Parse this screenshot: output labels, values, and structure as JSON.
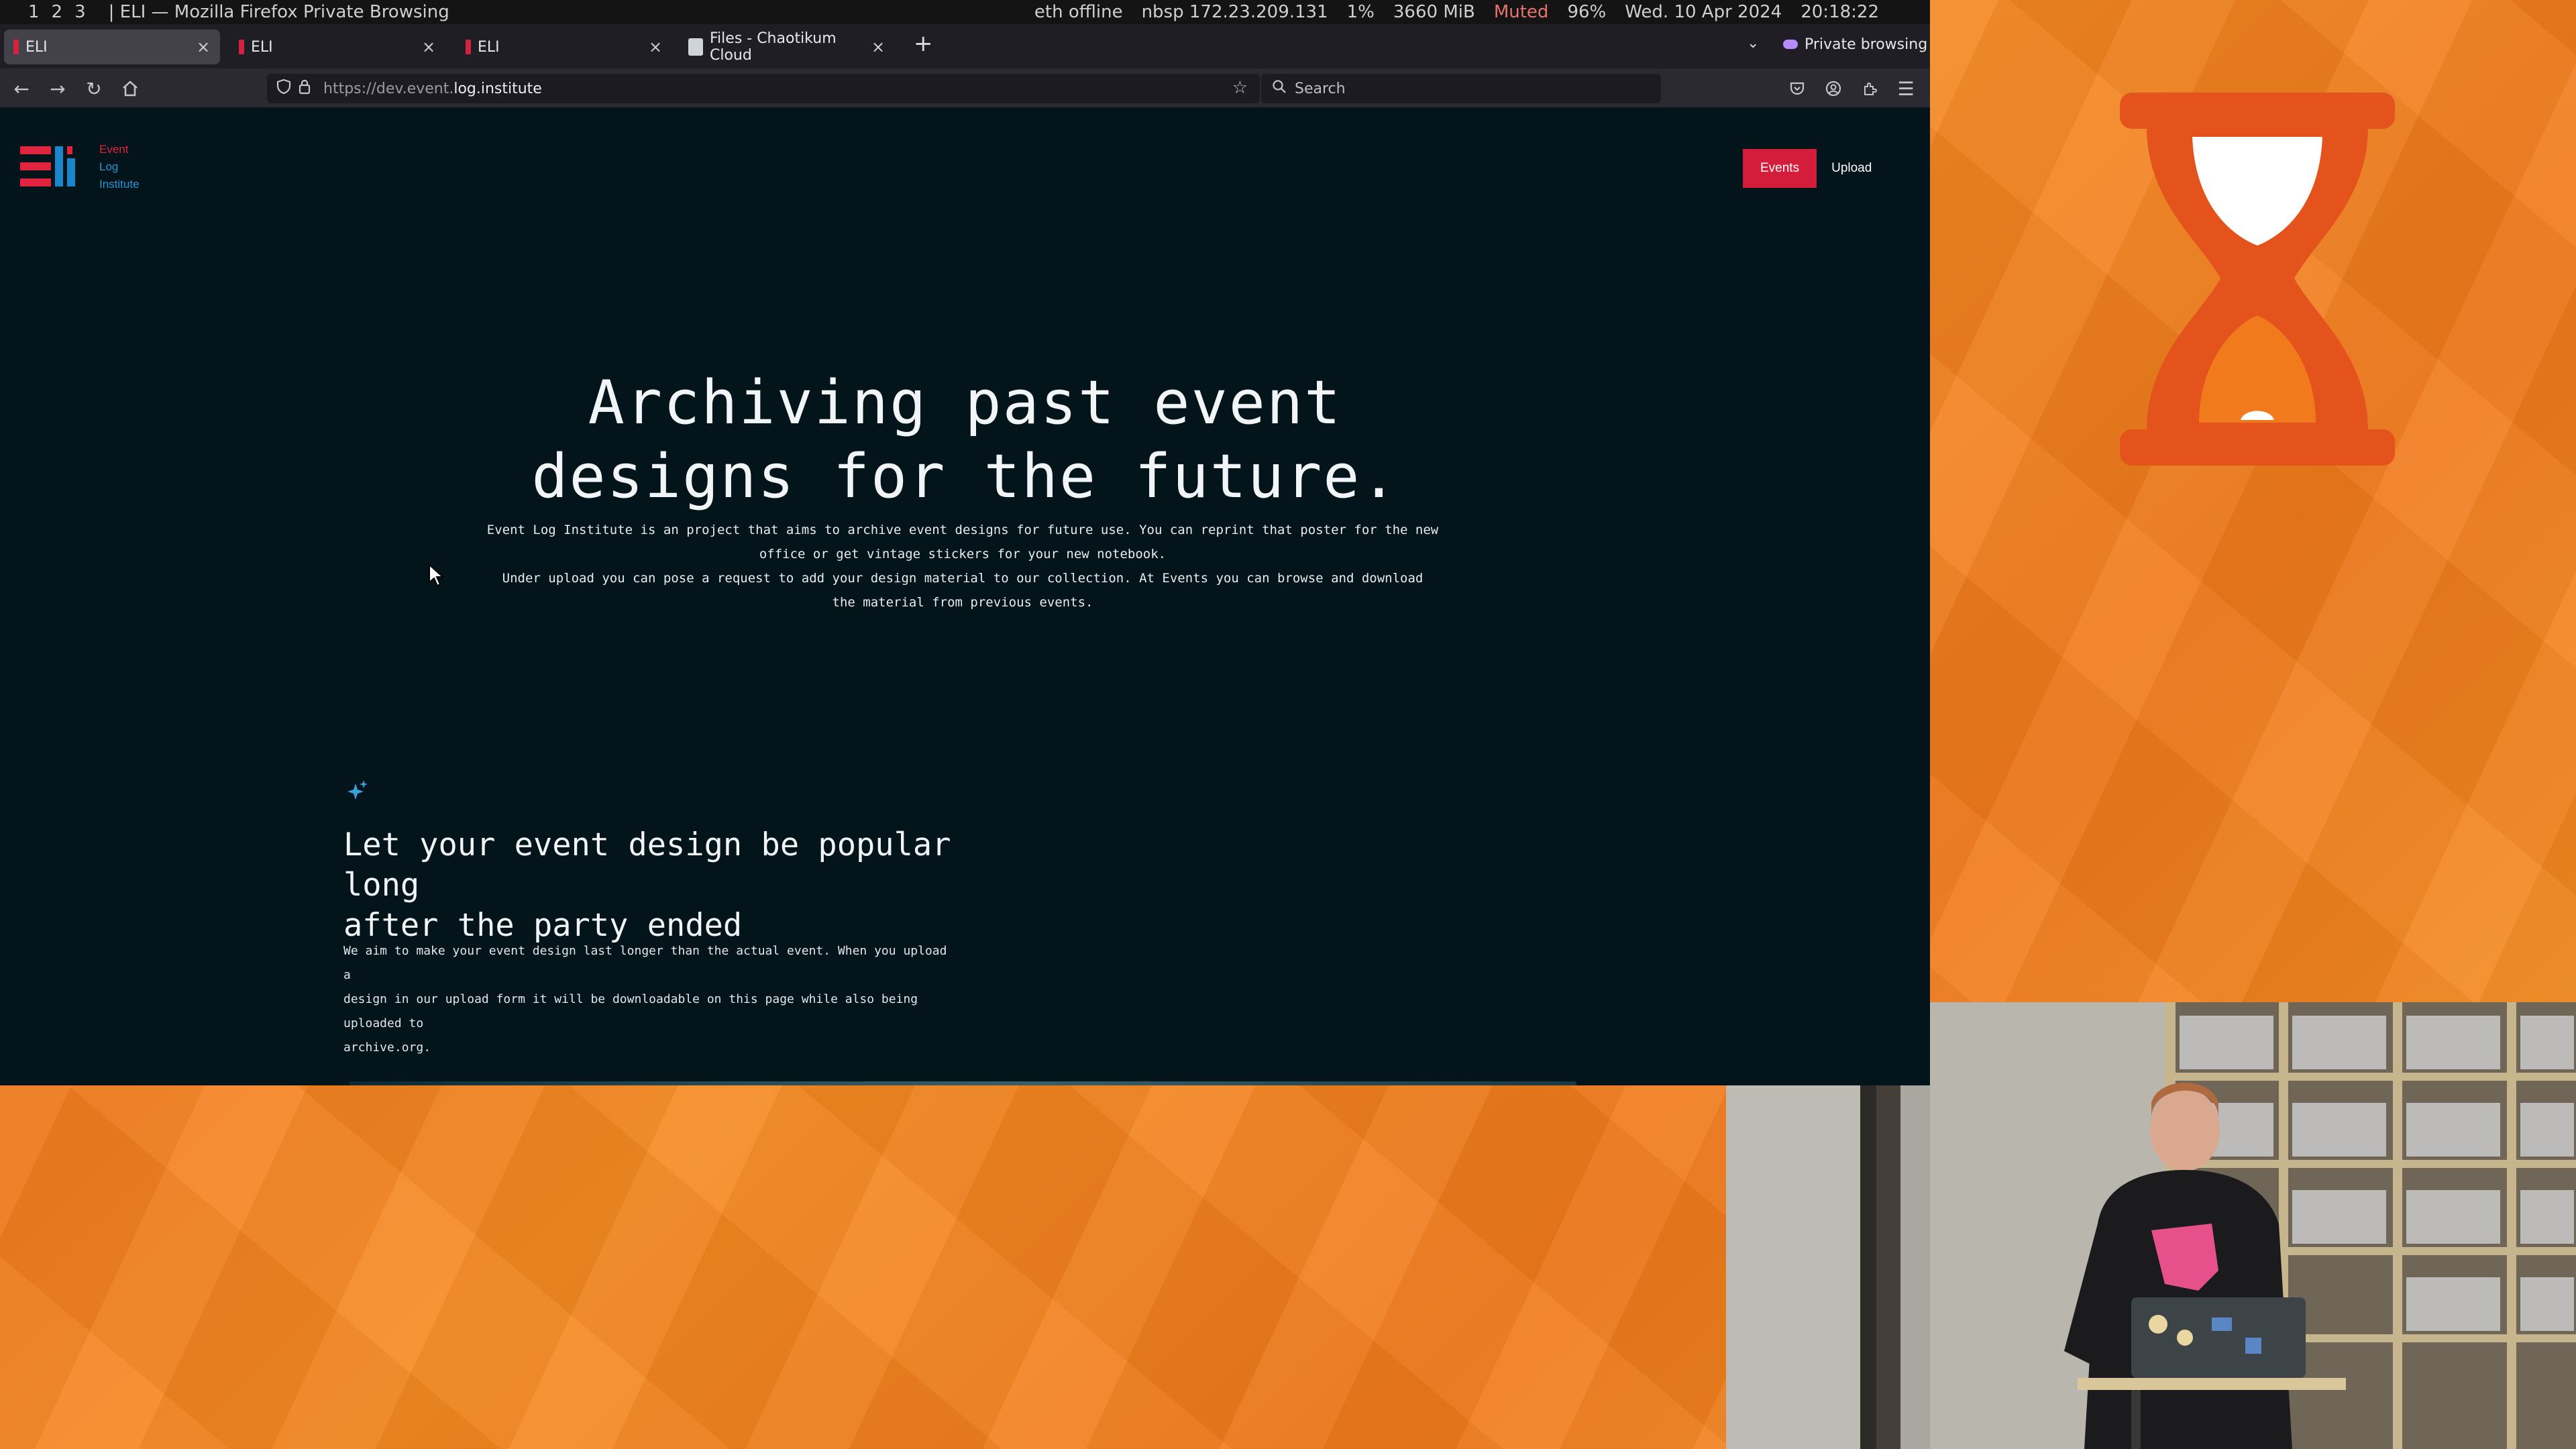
{
  "system_bar": {
    "workspaces": [
      "1",
      "2",
      "3"
    ],
    "window_title": "| ELI — Mozilla Firefox Private Browsing",
    "eth": "eth offline",
    "nbsp": "nbsp 172.23.209.131",
    "cpu": "1%",
    "mem": "3660 MiB",
    "volume": "Muted",
    "battery": "96%",
    "date": "Wed. 10 Apr 2024",
    "time": "20:18:22"
  },
  "tabs": [
    {
      "label": "ELI"
    },
    {
      "label": "ELI"
    },
    {
      "label": "ELI"
    },
    {
      "label": "Files - Chaotikum Cloud"
    }
  ],
  "private_label": "Private browsing",
  "url": {
    "prefix": "https://dev.event.",
    "host": "log.institute"
  },
  "search_placeholder": "Search",
  "logo": {
    "line1": "Event",
    "line2": "Log",
    "line3": "Institute"
  },
  "nav": {
    "events": "Events",
    "upload": "Upload"
  },
  "hero": {
    "line1": "Archiving past event",
    "line2": "designs for the future.",
    "para1a": "Event Log Institute is an project that aims to archive event designs for future use. You can reprint that poster for the new",
    "para1b": "office or get vintage stickers for your new notebook.",
    "para2a": "Under upload you can pose a request to add your design material to our collection. At Events you can browse and download",
    "para2b": "the material from previous events."
  },
  "feature": {
    "title1": "Let your event design be popular long",
    "title2": "after the party ended",
    "text1": "We aim to make your event design last longer than the actual event. When you upload a",
    "text2": "design in our upload form it will be downloadable on this page while also being uploaded to",
    "text3": "archive.org."
  },
  "colors": {
    "page_bg": "#03141a",
    "brand_red": "#d41d3b",
    "brand_blue": "#1a86c9",
    "stream_orange": "#f07a1c",
    "hourglass": "#e4531c"
  }
}
